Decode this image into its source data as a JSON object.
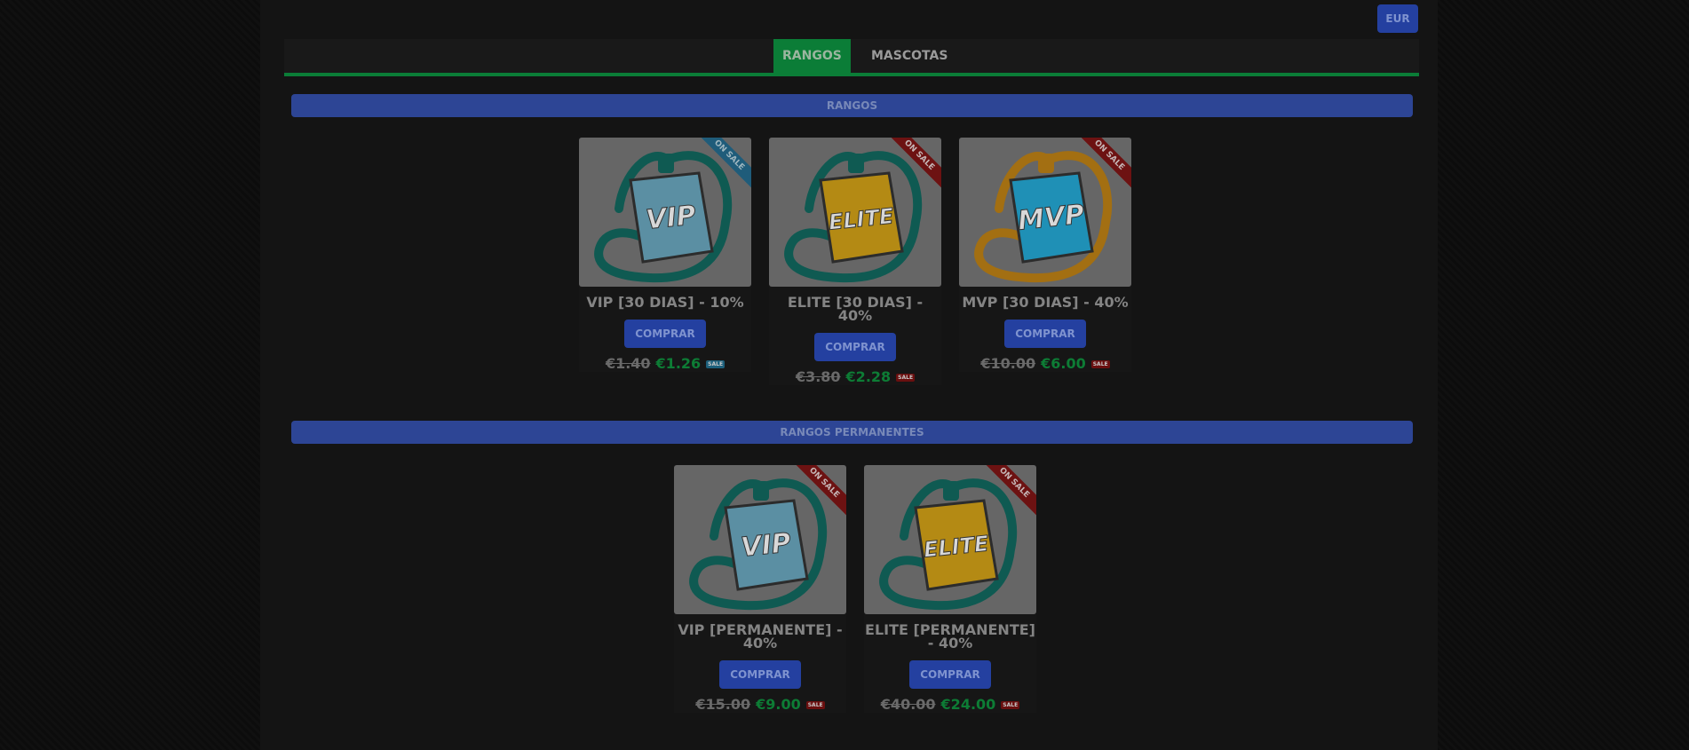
{
  "header": {
    "currency": "EUR"
  },
  "tabs": [
    {
      "label": "RANGOS",
      "active": true
    },
    {
      "label": "MASCOTAS",
      "active": false
    }
  ],
  "sections": [
    {
      "title": "RANGOS",
      "products": [
        {
          "badge": "VIP",
          "badge_color": "#5b8fa3",
          "lanyard_color": "#0f5a52",
          "ribbon": "ON SALE",
          "ribbon_color": "blue",
          "title": "VIP [30 DIAS] - 10%",
          "buy_label": "COMPRAR",
          "old_price": "€1.40",
          "new_price": "€1.26",
          "sale_tag": "SALE",
          "tag_color": "blue"
        },
        {
          "badge": "ELITE",
          "badge_color": "#b48a14",
          "lanyard_color": "#0f5a52",
          "ribbon": "ON SALE",
          "ribbon_color": "red",
          "title": "ELITE [30 DIAS] - 40%",
          "buy_label": "COMPRAR",
          "old_price": "€3.80",
          "new_price": "€2.28",
          "sale_tag": "SALE",
          "tag_color": "red"
        },
        {
          "badge": "MVP",
          "badge_color": "#1f90b6",
          "lanyard_color": "#a36f12",
          "ribbon": "ON SALE",
          "ribbon_color": "red",
          "title": "MVP [30 DIAS] - 40%",
          "buy_label": "COMPRAR",
          "old_price": "€10.00",
          "new_price": "€6.00",
          "sale_tag": "SALE",
          "tag_color": "red"
        }
      ]
    },
    {
      "title": "RANGOS PERMANENTES",
      "products": [
        {
          "badge": "VIP",
          "badge_color": "#5b8fa3",
          "lanyard_color": "#0f5a52",
          "ribbon": "ON SALE",
          "ribbon_color": "red",
          "title": "VIP [PERMANENTE] - 40%",
          "buy_label": "COMPRAR",
          "old_price": "€15.00",
          "new_price": "€9.00",
          "sale_tag": "SALE",
          "tag_color": "red"
        },
        {
          "badge": "ELITE",
          "badge_color": "#b48a14",
          "lanyard_color": "#0f5a52",
          "ribbon": "ON SALE",
          "ribbon_color": "red",
          "title": "ELITE [PERMANENTE] - 40%",
          "buy_label": "COMPRAR",
          "old_price": "€40.00",
          "new_price": "€24.00",
          "sale_tag": "SALE",
          "tag_color": "red"
        }
      ]
    }
  ]
}
